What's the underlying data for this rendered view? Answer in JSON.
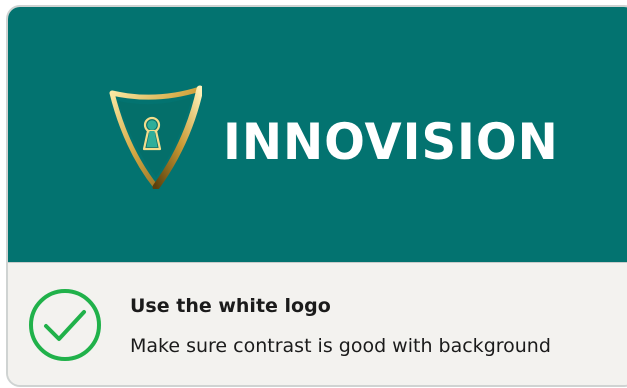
{
  "logo": {
    "brand_name": "INNOVISION",
    "icon": "shield-keyhole-icon",
    "background_color": "#037370",
    "wordmark_color": "#ffffff",
    "shield_colors": [
      "#f4dd8c",
      "#b88a2c",
      "#7a5a14"
    ],
    "keyhole_color": "#2fae9a"
  },
  "guideline": {
    "status_icon": "check-circle-icon",
    "status_color": "#20b14a",
    "title": "Use the white logo",
    "description": "Make sure contrast is good with background"
  }
}
